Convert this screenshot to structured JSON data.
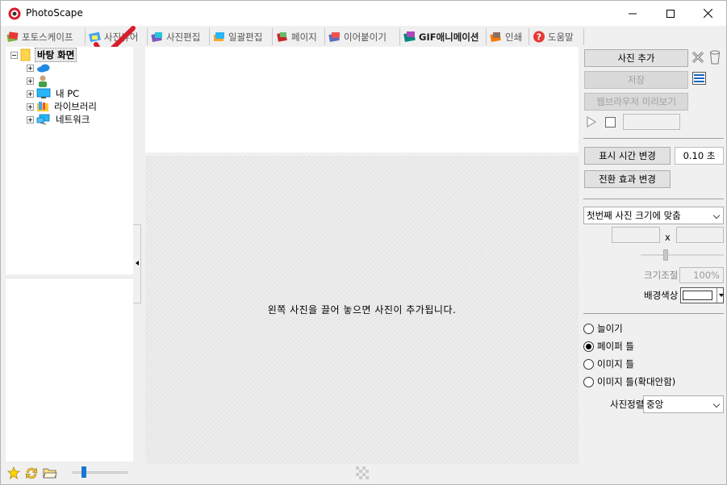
{
  "window": {
    "title": "PhotoScape"
  },
  "tabs": [
    {
      "label": "포토스케이프",
      "icon": "photoscape-home-icon"
    },
    {
      "label": "사진뷰어",
      "icon": "photo-viewer-icon"
    },
    {
      "label": "사진편집",
      "icon": "photo-editor-icon"
    },
    {
      "label": "일괄편집",
      "icon": "batch-editor-icon"
    },
    {
      "label": "페이지",
      "icon": "page-icon"
    },
    {
      "label": "이어붙이기",
      "icon": "combine-icon"
    },
    {
      "label": "GIF애니메이션",
      "icon": "gif-animation-icon"
    },
    {
      "label": "인쇄",
      "icon": "print-icon"
    },
    {
      "label": "도움말",
      "icon": "help-icon"
    }
  ],
  "tree": {
    "root": "바탕 화면",
    "items": [
      {
        "label": "",
        "icon": "onedrive-cloud-icon"
      },
      {
        "label": "",
        "icon": "user-folder-icon"
      },
      {
        "label": "내 PC",
        "icon": "this-pc-icon"
      },
      {
        "label": "라이브러리",
        "icon": "libraries-icon"
      },
      {
        "label": "네트워크",
        "icon": "network-icon"
      }
    ]
  },
  "center": {
    "drop_hint": "왼쪽 사진을 끌어 놓으면 사진이 추가됩니다."
  },
  "right": {
    "add_photo": "사진 추가",
    "save": "저장",
    "web_preview": "웹브라우저 미리보기",
    "display_time_button": "표시 시간 변경",
    "display_time_value": "0.10 초",
    "transition_button": "전환 효과 변경",
    "size_mode": "첫번째 사진 크기에 맞춤",
    "size_x_label": "x",
    "scale_label": "크기조절",
    "scale_value": "100%",
    "bg_color_label": "배경색상",
    "bg_color": "#ffffff",
    "radio_options": [
      {
        "label": "늘이기",
        "checked": false
      },
      {
        "label": "페이퍼 틀",
        "checked": true
      },
      {
        "label": "이미지 틀",
        "checked": false
      },
      {
        "label": "이미지 틀(확대안함)",
        "checked": false
      }
    ],
    "align_label": "사진정렬",
    "align_value": "중앙"
  },
  "colors": {
    "accent_red": "#d81e2c",
    "selection_bg": "#e8e8e8"
  }
}
